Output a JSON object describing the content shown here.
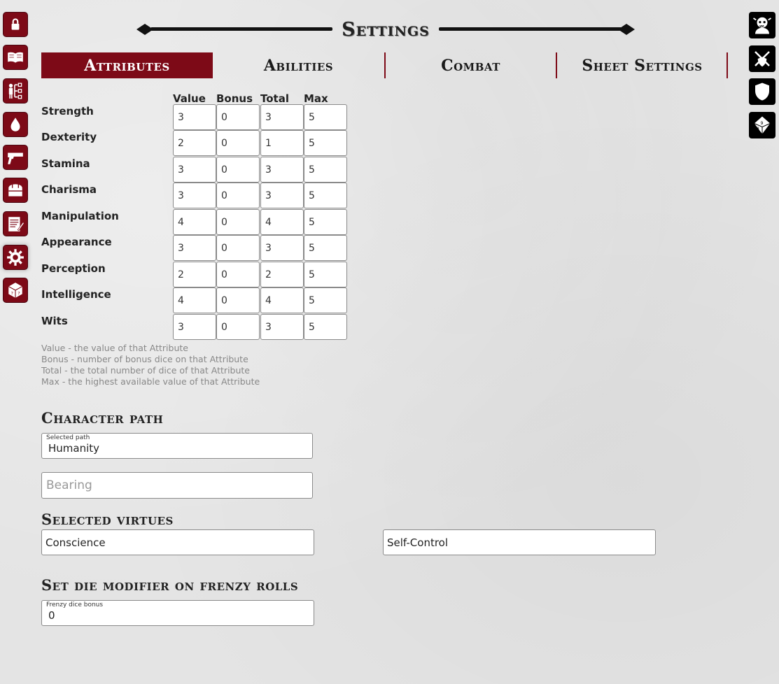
{
  "title": "Settings",
  "tabs": [
    {
      "label": "Attributes",
      "active": true
    },
    {
      "label": "Abilities",
      "active": false
    },
    {
      "label": "Combat",
      "active": false
    },
    {
      "label": "Sheet Settings",
      "active": false
    }
  ],
  "sidebar_icons": [
    "lock-icon",
    "book-icon",
    "family-tree-icon",
    "blood-drop-icon",
    "pistol-icon",
    "bag-icon",
    "notes-icon",
    "gear-icon",
    "dice-icon"
  ],
  "right_icons": [
    "ghoul-icon",
    "crossed-swords-icon",
    "shield-icon",
    "d10-dice-icon"
  ],
  "colors": {
    "accent": "#7d0a17",
    "background": "#e4e4e4"
  },
  "attributes": {
    "headers": {
      "value": "Value",
      "bonus": "Bonus",
      "total": "Total",
      "max": "Max"
    },
    "rows": [
      {
        "name": "Strength",
        "value": "3",
        "bonus": "0",
        "total": "3",
        "max": "5"
      },
      {
        "name": "Dexterity",
        "value": "2",
        "bonus": "0",
        "total": "1",
        "max": "5"
      },
      {
        "name": "Stamina",
        "value": "3",
        "bonus": "0",
        "total": "3",
        "max": "5"
      },
      {
        "name": "Charisma",
        "value": "3",
        "bonus": "0",
        "total": "3",
        "max": "5"
      },
      {
        "name": "Manipulation",
        "value": "4",
        "bonus": "0",
        "total": "4",
        "max": "5"
      },
      {
        "name": "Appearance",
        "value": "3",
        "bonus": "0",
        "total": "3",
        "max": "5"
      },
      {
        "name": "Perception",
        "value": "2",
        "bonus": "0",
        "total": "2",
        "max": "5"
      },
      {
        "name": "Intelligence",
        "value": "4",
        "bonus": "0",
        "total": "4",
        "max": "5"
      },
      {
        "name": "Wits",
        "value": "3",
        "bonus": "0",
        "total": "3",
        "max": "5"
      }
    ],
    "legend": [
      "Value - the value of that Attribute",
      "Bonus - number of bonus dice on that Attribute",
      "Total - the total number of dice of that Attribute",
      "Max - the highest available value of that Attribute"
    ]
  },
  "character_path": {
    "title": "Character path",
    "selected_label": "Selected path",
    "selected_value": "Humanity",
    "bearing_placeholder": "Bearing"
  },
  "virtues": {
    "title": "Selected virtues",
    "first": "Conscience",
    "second": "Self-Control"
  },
  "frenzy": {
    "title": "Set die modifier on frenzy rolls",
    "label": "Frenzy dice bonus",
    "value": "0"
  }
}
